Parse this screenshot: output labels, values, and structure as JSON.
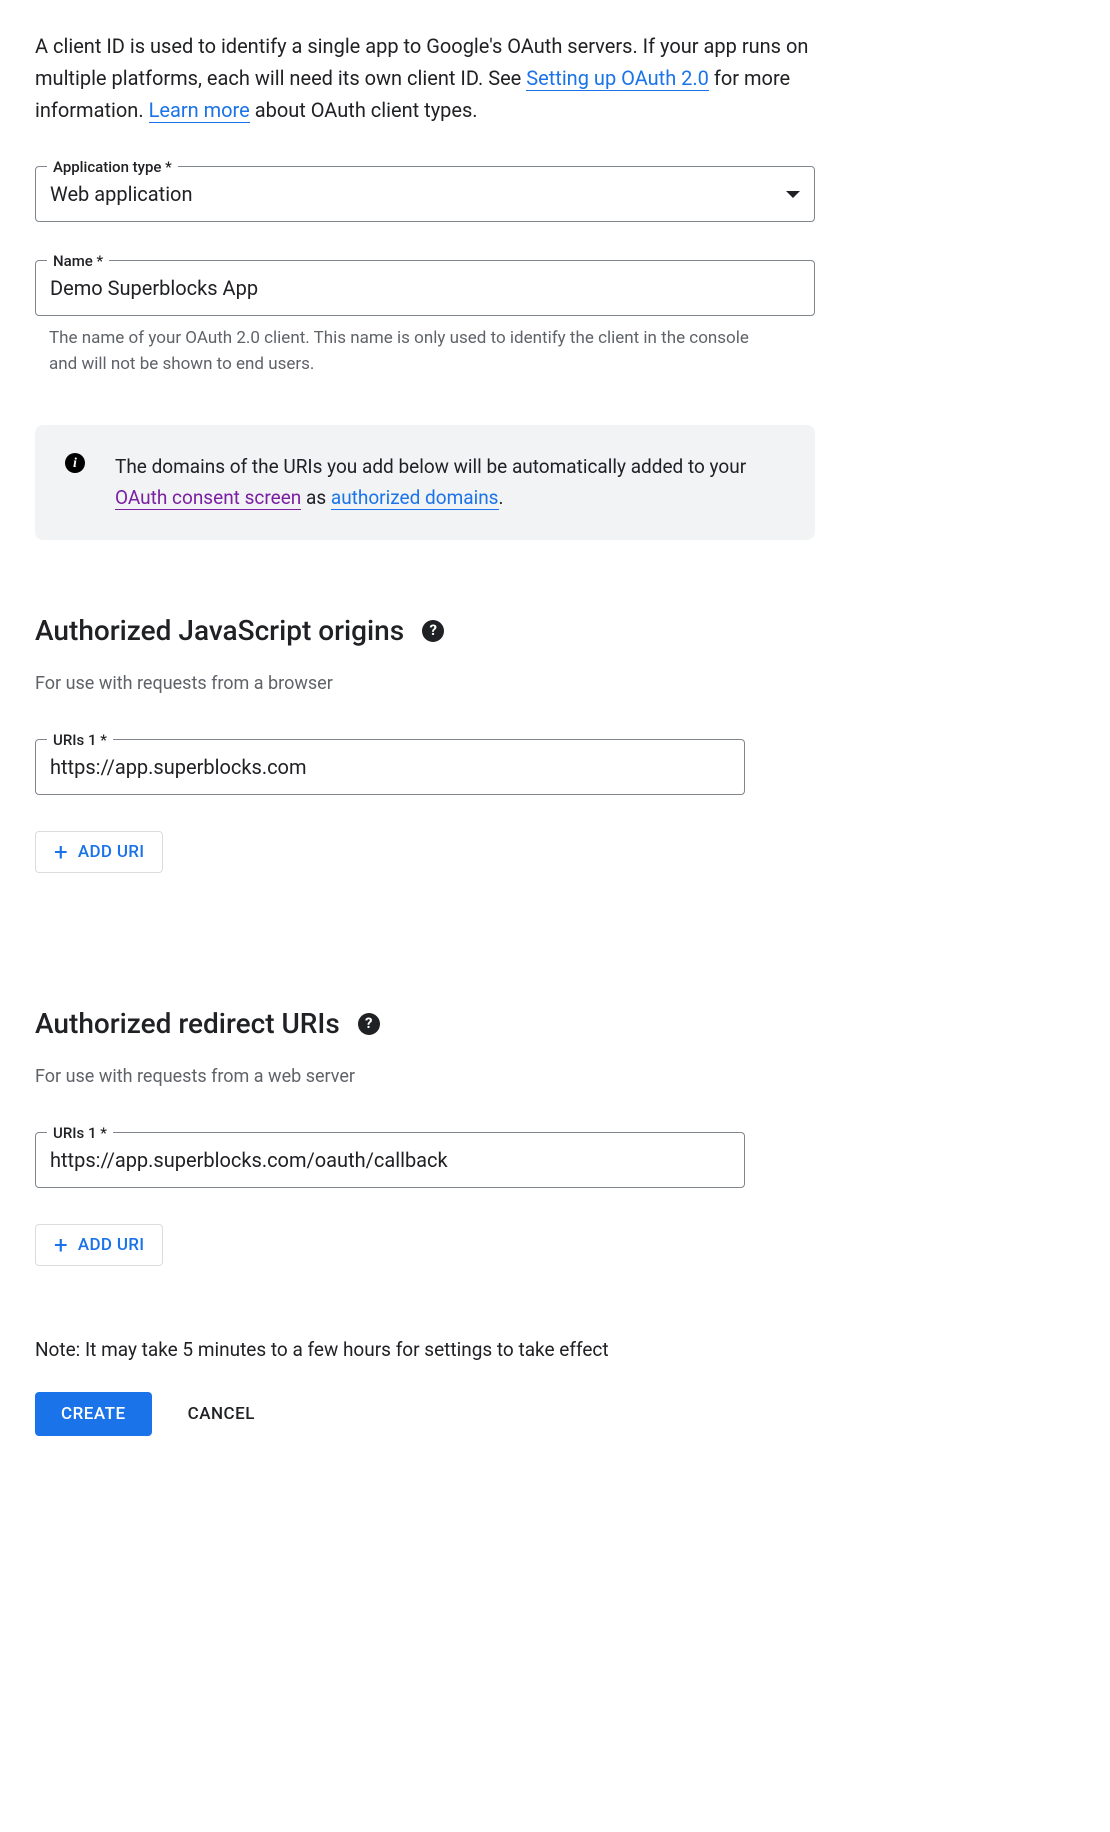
{
  "intro": {
    "text_before_link1": "A client ID is used to identify a single app to Google's OAuth servers. If your app runs on multiple platforms, each will need its own client ID. See ",
    "link1": "Setting up OAuth 2.0",
    "text_between": " for more information. ",
    "link2": "Learn more",
    "text_after": " about OAuth client types."
  },
  "appType": {
    "label": "Application type *",
    "value": "Web application"
  },
  "name": {
    "label": "Name *",
    "value": "Demo Superblocks App",
    "helper": "The name of your OAuth 2.0 client. This name is only used to identify the client in the console and will not be shown to end users."
  },
  "infoBox": {
    "text_before": "The domains of the URIs you add below will be automatically added to your ",
    "link1": "OAuth consent screen",
    "text_mid": " as ",
    "link2": "authorized domains",
    "text_after": "."
  },
  "jsOrigins": {
    "title": "Authorized JavaScript origins",
    "subtitle": "For use with requests from a browser",
    "uriLabel": "URIs 1 *",
    "uriValue": "https://app.superblocks.com",
    "addBtn": "ADD URI"
  },
  "redirectUris": {
    "title": "Authorized redirect URIs",
    "subtitle": "For use with requests from a web server",
    "uriLabel": "URIs 1 *",
    "uriValue": "https://app.superblocks.com/oauth/callback",
    "addBtn": "ADD URI"
  },
  "note": "Note: It may take 5 minutes to a few hours for settings to take effect",
  "buttons": {
    "create": "CREATE",
    "cancel": "CANCEL"
  }
}
